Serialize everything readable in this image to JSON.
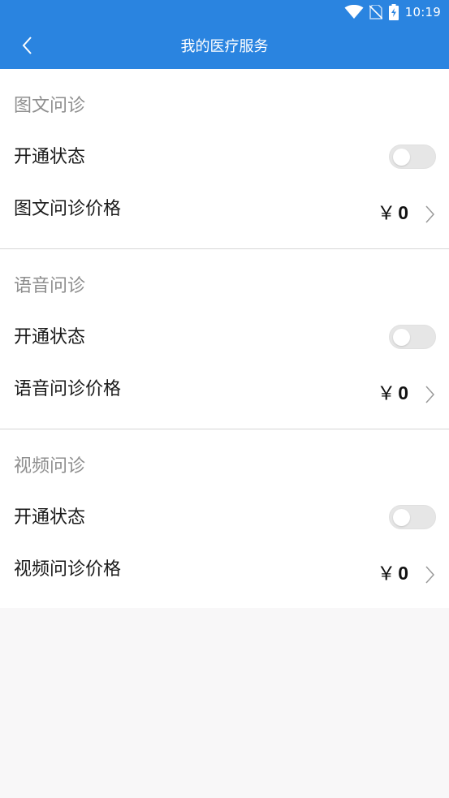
{
  "status_bar": {
    "time": "10:19",
    "icons": [
      "wifi-icon",
      "no-sim-icon",
      "battery-charging-icon"
    ]
  },
  "header": {
    "title": "我的医疗服务",
    "back_icon": "chevron-left-icon"
  },
  "colors": {
    "primary": "#2a84e0",
    "section_title": "#8e8e8e",
    "text": "#1a1a1a",
    "toggle_off": "#e6e6e6",
    "background": "#f8f7f8"
  },
  "sections": [
    {
      "title": "图文问诊",
      "status_label": "开通状态",
      "status_on": false,
      "price_label": "图文问诊价格",
      "currency": "￥",
      "price": "0"
    },
    {
      "title": "语音问诊",
      "status_label": "开通状态",
      "status_on": false,
      "price_label": "语音问诊价格",
      "currency": "￥",
      "price": "0"
    },
    {
      "title": "视频问诊",
      "status_label": "开通状态",
      "status_on": false,
      "price_label": "视频问诊价格",
      "currency": "￥",
      "price": "0"
    }
  ]
}
